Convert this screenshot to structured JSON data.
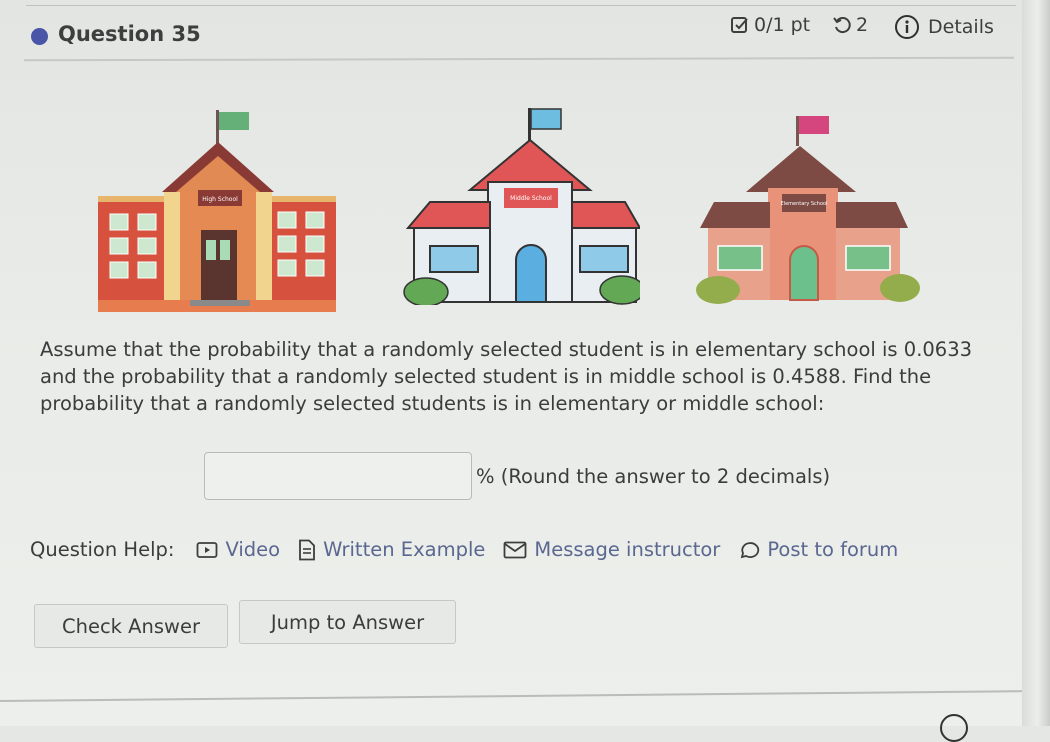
{
  "header": {
    "question_title": "Question 35",
    "score": "0/1 pt",
    "tries": "2",
    "details_label": "Details",
    "icons": {
      "bullet": "question-status-dot",
      "score": "checkbox-icon",
      "tries": "retry-icon",
      "details": "info-icon"
    },
    "accent_color": "#4a55a8"
  },
  "illustrations": [
    {
      "name": "high-school",
      "sign": "High School",
      "flag_color": "#5faa78"
    },
    {
      "name": "middle-school",
      "sign": "Middle School",
      "flag_color": "#5fb2d8"
    },
    {
      "name": "elementary-school",
      "sign": "Elementary School",
      "flag_color": "#d6467e"
    }
  ],
  "question": {
    "text": "Assume that the probability that a randomly selected student is in elementary school is 0.0633 and the probability that a randomly selected student is in middle school is 0.4588. Find the probability that a randomly selected students is in elementary or middle school:",
    "answer_value": "",
    "answer_placeholder": "",
    "answer_suffix": "% (Round the answer to 2 decimals)"
  },
  "help": {
    "label": "Question Help:",
    "links": [
      {
        "label": "Video",
        "icon": "video-icon"
      },
      {
        "label": "Written Example",
        "icon": "document-icon"
      },
      {
        "label": "Message instructor",
        "icon": "mail-icon"
      },
      {
        "label": "Post to forum",
        "icon": "chat-bubble-icon"
      }
    ],
    "link_color": "#5a6790"
  },
  "buttons": {
    "check_answer": "Check Answer",
    "jump_to_answer": "Jump to Answer"
  }
}
